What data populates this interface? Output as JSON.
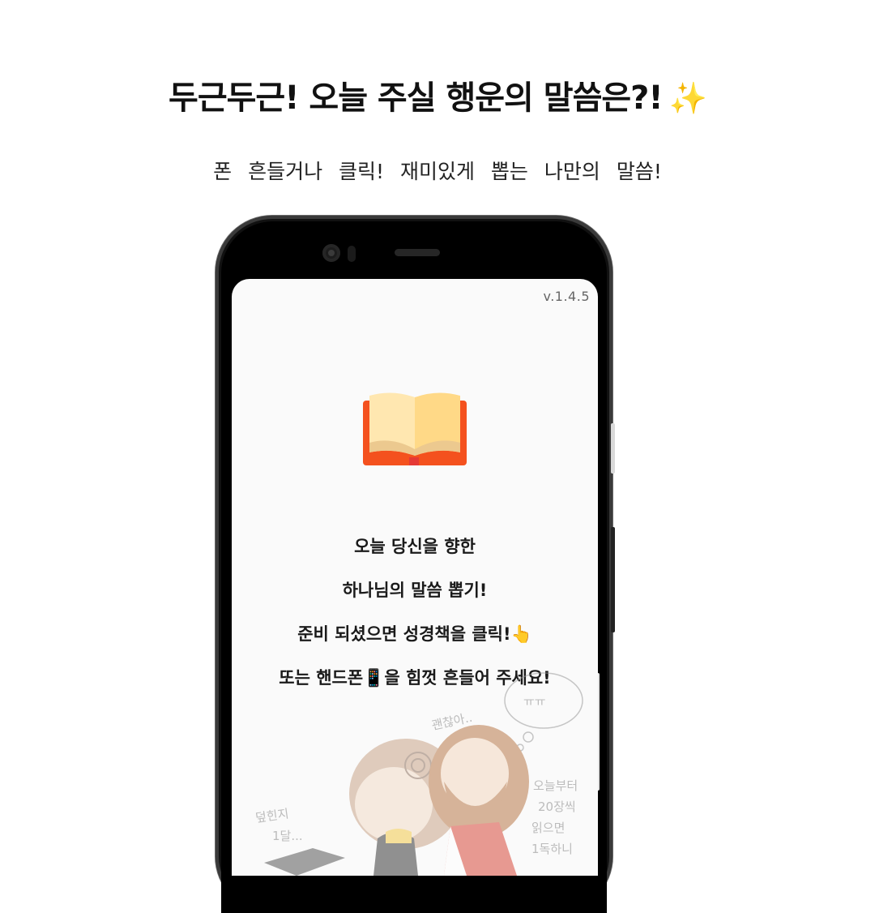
{
  "header": {
    "headline": "두근두근! 오늘 주실 행운의 말씀은?!",
    "headline_sparkle": "✨",
    "subline": "폰 흔들거나 클릭! 재미있게 뽑는 나만의 말씀!"
  },
  "app": {
    "version": "v.1.4.5",
    "book_icon": "open-book-icon",
    "messages": {
      "line1": "오늘 당신을 향한",
      "line2": "하나님의 말씀 뽑기!",
      "line3": "준비 되셨으면 성경책을 클릭!",
      "line3_emoji": "👆",
      "line4_a": "또는 핸드폰",
      "line4_emoji": "📱",
      "line4_b": "을 힘껏 흔들어 주세요!"
    },
    "illustration": {
      "bubble_text": "ㅠㅠ",
      "caption_top": "괜찮아..",
      "caption_left_1": "덮힌지",
      "caption_left_2": "1달...",
      "caption_right_1": "오늘부터",
      "caption_right_2": "20장씩",
      "caption_right_3": "읽으면",
      "caption_right_4": "1독하니"
    }
  },
  "colors": {
    "book_cover": "#f4511e",
    "book_page_left": "#ffe7b0",
    "book_page_right": "#ffd987",
    "bookmark": "#e53935",
    "background": "#ffffff",
    "screen": "#fafafa"
  }
}
